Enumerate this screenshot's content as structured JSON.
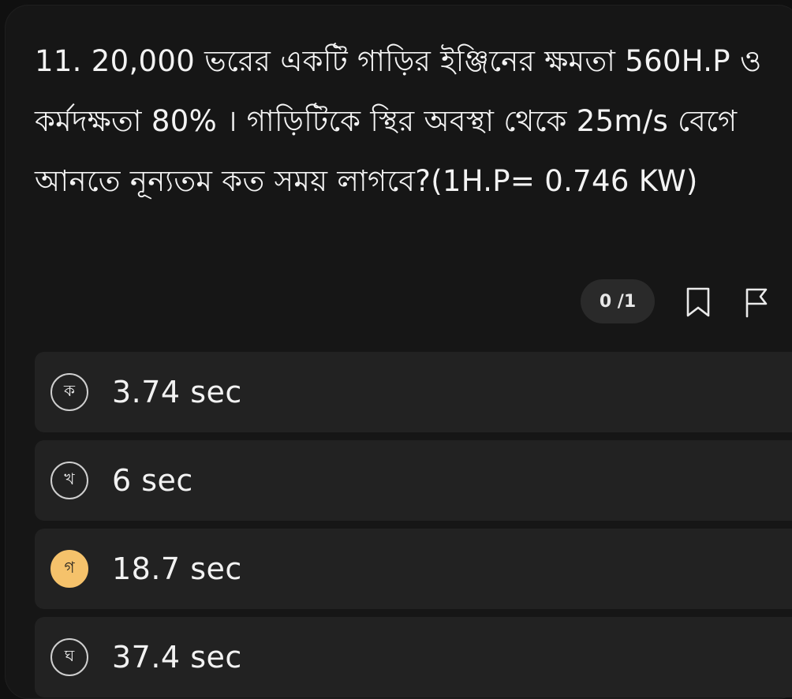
{
  "question": {
    "text": "11. 20,000 ভরের একটি গাড়ির ইঞ্জিনের ক্ষমতা 560H.P ও কর্মদক্ষতা 80% । গাড়িটিকে স্থির অবস্থা থেকে 25m/s বেগে আনতে নূন্যতম কত সময় লাগবে?(1H.P= 0.746 KW)"
  },
  "toolbar": {
    "counter": "0 /1",
    "bookmark_icon": "bookmark-icon",
    "flag_icon": "flag-icon"
  },
  "options": [
    {
      "letter": "ক",
      "text": "3.74 sec",
      "selected": false
    },
    {
      "letter": "খ",
      "text": "6 sec",
      "selected": false
    },
    {
      "letter": "গ",
      "text": "18.7 sec",
      "selected": true
    },
    {
      "letter": "ঘ",
      "text": "37.4 sec",
      "selected": false
    }
  ],
  "colors": {
    "background": "#161616",
    "option_bg": "#222222",
    "selected_accent": "#f5c26b",
    "counter_bg": "#2a2a2a"
  }
}
